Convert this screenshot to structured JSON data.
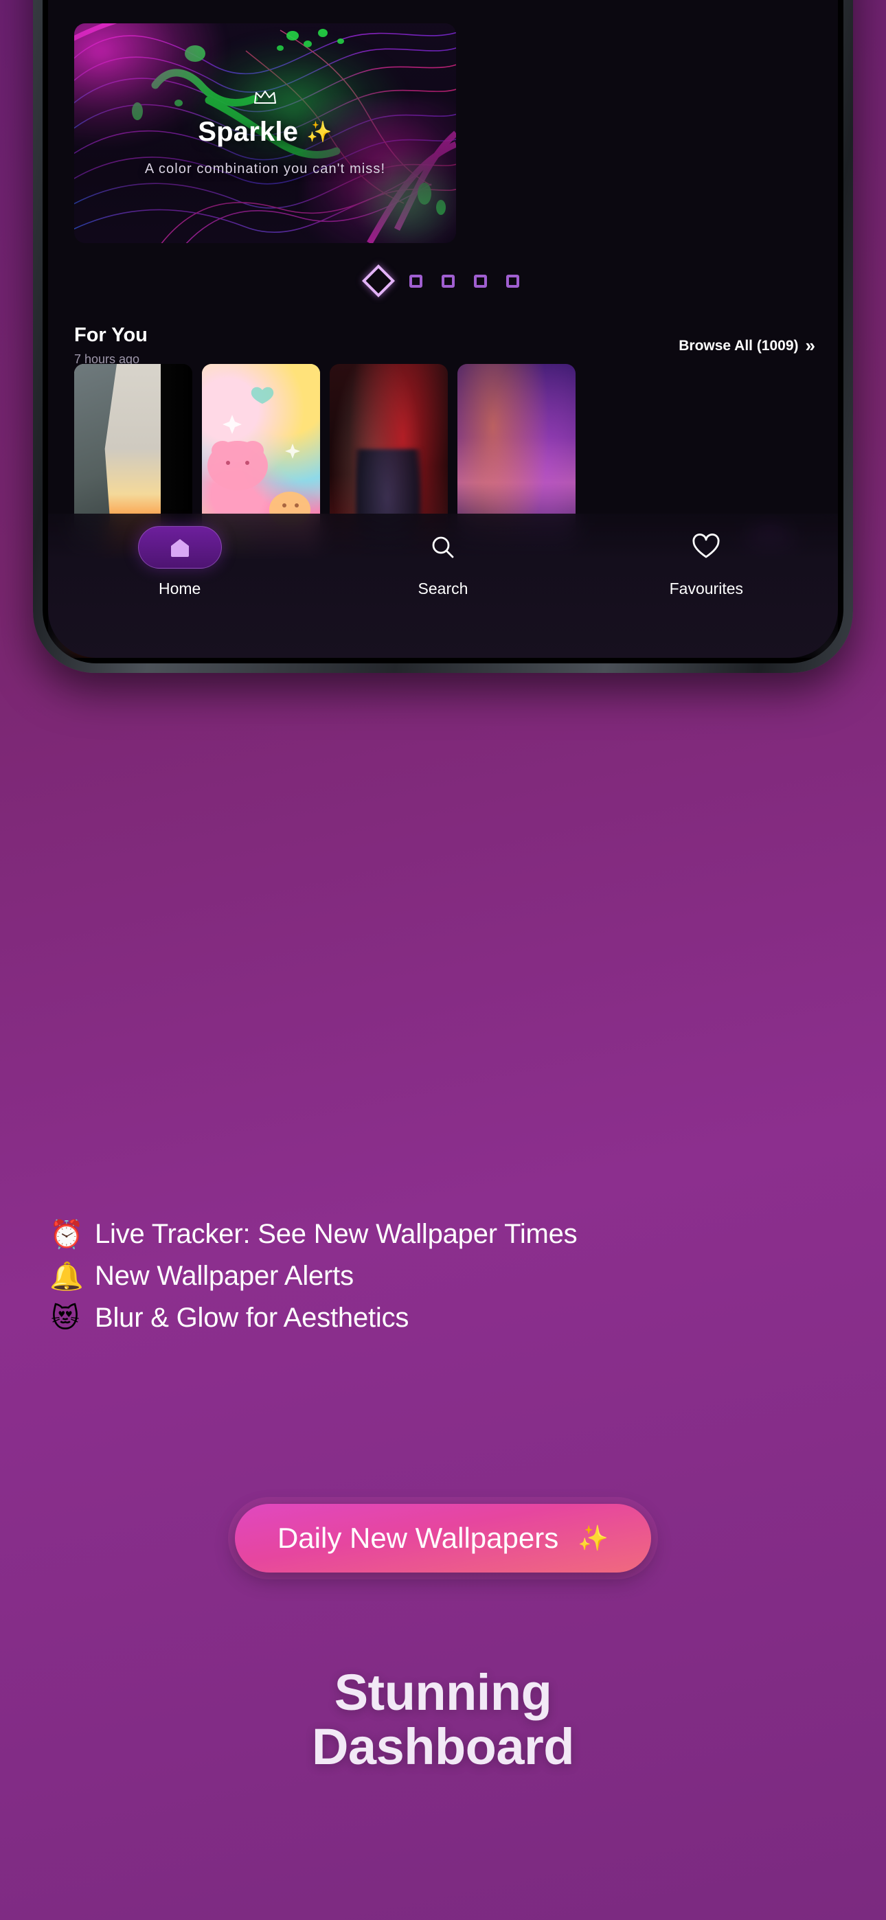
{
  "app": {
    "hero": {
      "crown_icon": "crown-icon",
      "title": "Sparkle",
      "title_sparkle": "✨",
      "subtitle": "A color combination you can't miss!"
    },
    "carousel": {
      "indicators": [
        {
          "shape": "diamond",
          "active": true
        },
        {
          "shape": "square",
          "active": false
        },
        {
          "shape": "square",
          "active": false
        },
        {
          "shape": "square",
          "active": false
        },
        {
          "shape": "square",
          "active": false
        }
      ]
    },
    "for_you": {
      "title": "For You",
      "timestamp": "7 hours ago",
      "browse_all_label": "Browse All (1009)",
      "browse_all_chevron": "»",
      "thumbnails": [
        {
          "name": "mountain-sunset-wallpaper"
        },
        {
          "name": "kawaii-pastel-wallpaper"
        },
        {
          "name": "red-cape-hero-wallpaper"
        },
        {
          "name": "aurora-mountains-wallpaper"
        }
      ],
      "scroll_fab_icon": "chevron-down-icon"
    },
    "bottom_nav": [
      {
        "label": "Home",
        "icon": "home-icon",
        "active": true
      },
      {
        "label": "Search",
        "icon": "search-icon",
        "active": false
      },
      {
        "label": "Favourites",
        "icon": "heart-icon",
        "active": false
      }
    ]
  },
  "promo": {
    "features": [
      {
        "emoji": "⏰",
        "text": "Live Tracker: See New Wallpaper Times"
      },
      {
        "emoji": "🔔",
        "text": "New Wallpaper Alerts"
      },
      {
        "emoji": "😻",
        "text": "Blur & Glow for Aesthetics"
      }
    ],
    "cta": {
      "label": "Daily New Wallpapers",
      "sparkle": "✨"
    },
    "headline_line1": "Stunning",
    "headline_line2": "Dashboard"
  },
  "colors": {
    "background_top": "#6b2070",
    "background_mid": "#8c2f8e",
    "accent_purple": "#6a1f95",
    "indicator_active": "#e2b3f7",
    "indicator_inactive": "#a05fd0",
    "cta_gradient_start": "#e048c0",
    "cta_gradient_end": "#f06a7e"
  }
}
